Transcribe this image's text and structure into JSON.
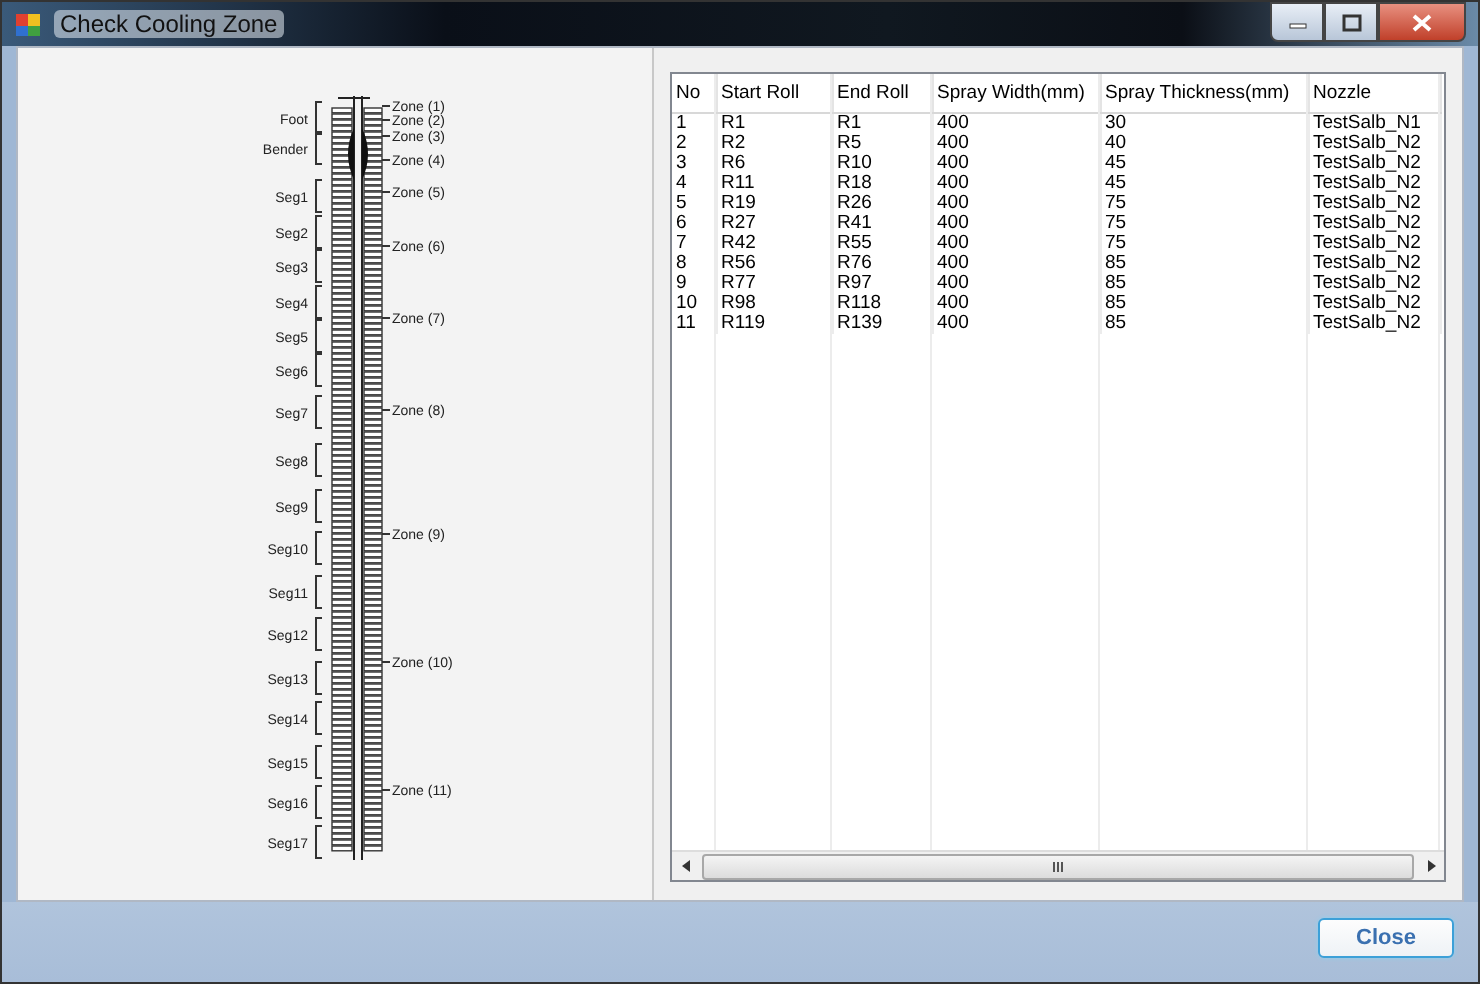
{
  "window": {
    "title": "Check Cooling Zone"
  },
  "diagram": {
    "segments": [
      "Foot",
      "Bender",
      "Seg1",
      "Seg2",
      "Seg3",
      "Seg4",
      "Seg5",
      "Seg6",
      "Seg7",
      "Seg8",
      "Seg9",
      "Seg10",
      "Seg11",
      "Seg12",
      "Seg13",
      "Seg14",
      "Seg15",
      "Seg16",
      "Seg17"
    ],
    "zones": [
      "Zone (1)",
      "Zone (2)",
      "Zone (3)",
      "Zone (4)",
      "Zone (5)",
      "Zone (6)",
      "Zone (7)",
      "Zone (8)",
      "Zone (9)",
      "Zone (10)",
      "Zone (11)"
    ]
  },
  "table": {
    "columns": [
      "No",
      "Start Roll",
      "End Roll",
      "Spray Width(mm)",
      "Spray Thickness(mm)",
      "Nozzle"
    ],
    "rows": [
      [
        "1",
        "R1",
        "R1",
        "400",
        "30",
        "TestSalb_N1"
      ],
      [
        "2",
        "R2",
        "R5",
        "400",
        "40",
        "TestSalb_N2"
      ],
      [
        "3",
        "R6",
        "R10",
        "400",
        "45",
        "TestSalb_N2"
      ],
      [
        "4",
        "R11",
        "R18",
        "400",
        "45",
        "TestSalb_N2"
      ],
      [
        "5",
        "R19",
        "R26",
        "400",
        "75",
        "TestSalb_N2"
      ],
      [
        "6",
        "R27",
        "R41",
        "400",
        "75",
        "TestSalb_N2"
      ],
      [
        "7",
        "R42",
        "R55",
        "400",
        "75",
        "TestSalb_N2"
      ],
      [
        "8",
        "R56",
        "R76",
        "400",
        "85",
        "TestSalb_N2"
      ],
      [
        "9",
        "R77",
        "R97",
        "400",
        "85",
        "TestSalb_N2"
      ],
      [
        "10",
        "R98",
        "R118",
        "400",
        "85",
        "TestSalb_N2"
      ],
      [
        "11",
        "R119",
        "R139",
        "400",
        "85",
        "TestSalb_N2"
      ]
    ]
  },
  "buttons": [
    {
      "label": "Close"
    }
  ]
}
